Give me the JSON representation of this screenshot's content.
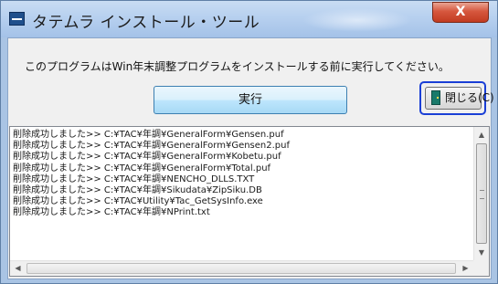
{
  "window": {
    "title": "タテムラ インストール・ツール",
    "close_glyph": "X"
  },
  "main": {
    "instruction": "このプログラムはWin年末調整プログラムをインストールする前に実行してください。",
    "run_button_label": "実行",
    "close_button_label": "閉じる(C)"
  },
  "log": {
    "lines": [
      "削除成功しました>> C:¥TAC¥年調¥GeneralForm¥Gensen.puf",
      "削除成功しました>> C:¥TAC¥年調¥GeneralForm¥Gensen2.puf",
      "削除成功しました>> C:¥TAC¥年調¥GeneralForm¥Kobetu.puf",
      "削除成功しました>> C:¥TAC¥年調¥GeneralForm¥Total.puf",
      "削除成功しました>> C:¥TAC¥年調¥NENCHO_DLLS.TXT",
      "削除成功しました>> C:¥TAC¥年調¥Sikudata¥ZipSiku.DB",
      "削除成功しました>> C:¥TAC¥Utility¥Tac_GetSysInfo.exe",
      "削除成功しました>> C:¥TAC¥年調¥NPrint.txt"
    ]
  },
  "colors": {
    "highlight_border": "#1a3fd6",
    "close_button_red": "#c23b21",
    "window_frame": "#a9c4e4"
  },
  "icons": {
    "app": "app-icon",
    "close_button": "door-icon"
  }
}
